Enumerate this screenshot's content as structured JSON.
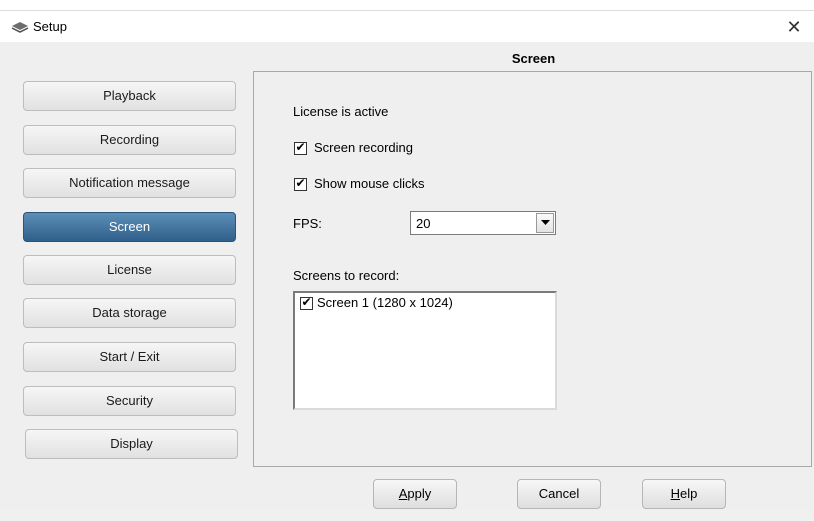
{
  "window": {
    "title": "Setup",
    "close_symbol": "✕"
  },
  "sidebar": {
    "items": [
      {
        "label": "Playback",
        "active": false
      },
      {
        "label": "Recording",
        "active": false
      },
      {
        "label": "Notification message",
        "active": false
      },
      {
        "label": "Screen",
        "active": true
      },
      {
        "label": "License",
        "active": false
      },
      {
        "label": "Data storage",
        "active": false
      },
      {
        "label": "Start / Exit",
        "active": false
      },
      {
        "label": "Security",
        "active": false
      },
      {
        "label": "Display",
        "active": false
      }
    ]
  },
  "panel": {
    "title": "Screen",
    "license_status": "License is active",
    "screen_recording": {
      "label": "Screen recording",
      "checked": true
    },
    "show_mouse_clicks": {
      "label": "Show mouse clicks",
      "checked": true
    },
    "fps": {
      "label": "FPS:",
      "value": "20"
    },
    "screens_to_record": {
      "label": "Screens to record:",
      "items": [
        {
          "label": "Screen 1 (1280 x 1024)",
          "checked": true
        }
      ]
    }
  },
  "footer": {
    "apply": {
      "mnemonic": "A",
      "rest": "pply"
    },
    "cancel": "Cancel",
    "help": {
      "mnemonic": "H",
      "rest": "elp"
    }
  },
  "colors": {
    "active_nav": "#3f6f9a",
    "window_bg": "#f0f0f0"
  },
  "icons": {
    "app": "setup-icon",
    "close": "close-icon",
    "dropdown": "chevron-down-icon",
    "check": "checkmark-icon"
  }
}
